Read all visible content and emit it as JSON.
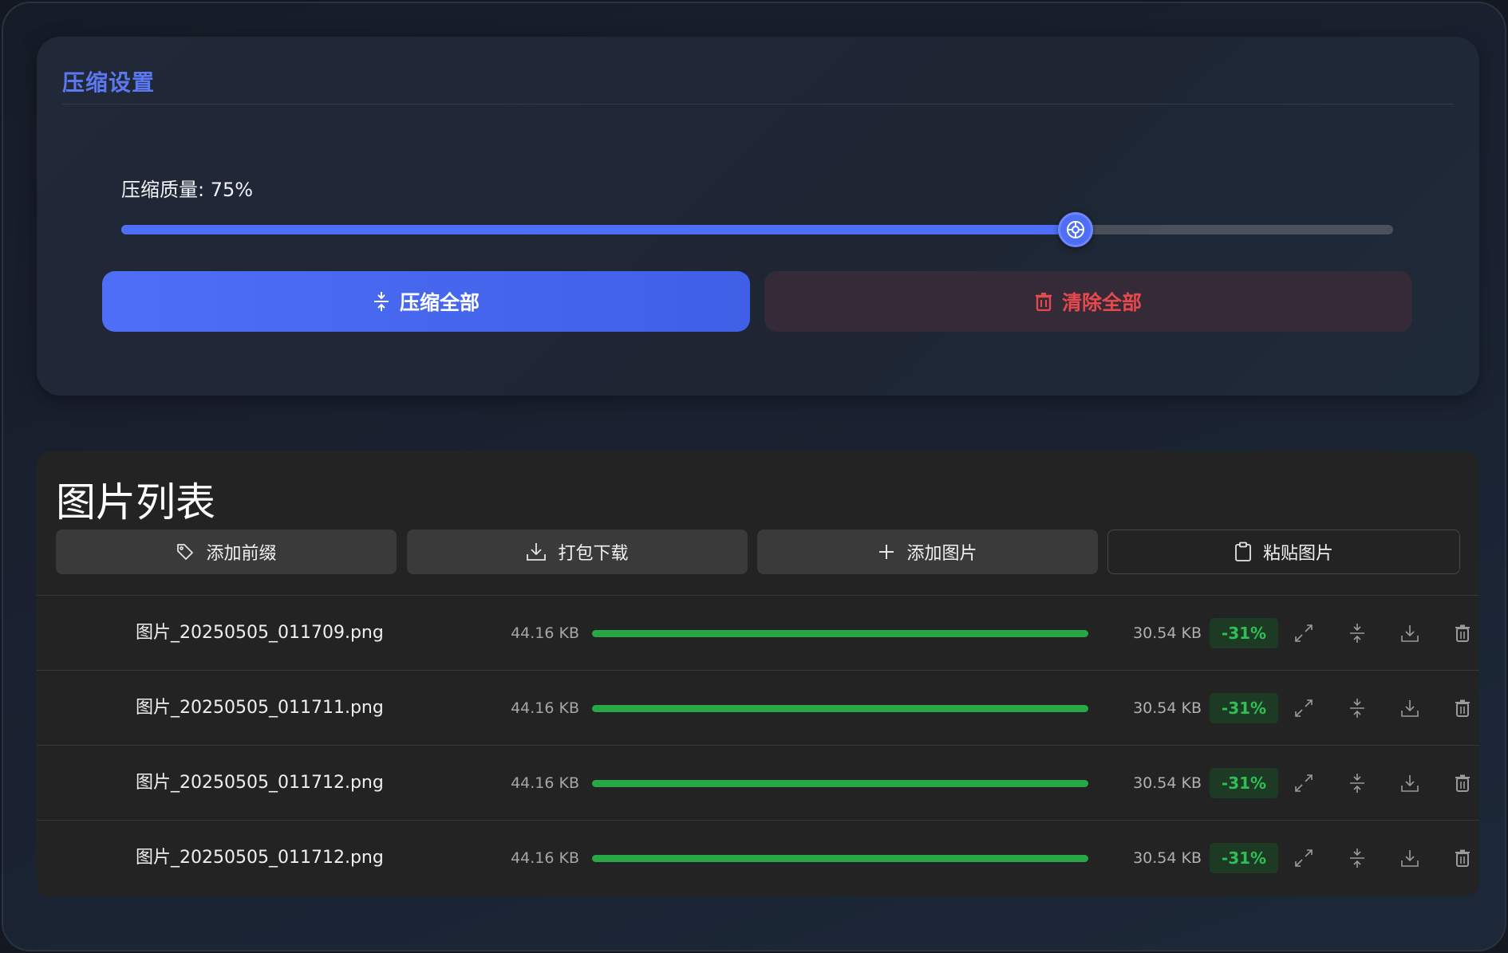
{
  "settings": {
    "title": "压缩设置",
    "quality_label": "压缩质量: 75%",
    "quality_value": 0.75,
    "compress_all_label": "压缩全部",
    "clear_all_label": "清除全部"
  },
  "image_list": {
    "title": "图片列表",
    "toolbar": {
      "add_prefix": "添加前缀",
      "pack_download": "打包下载",
      "add_image": "添加图片",
      "paste_image": "粘贴图片"
    },
    "rows": [
      {
        "filename": "图片_20250505_011709.png",
        "original_size": "44.16 KB",
        "progress": 1.0,
        "compressed_size": "30.54 KB",
        "ratio": "-31%"
      },
      {
        "filename": "图片_20250505_011711.png",
        "original_size": "44.16 KB",
        "progress": 1.0,
        "compressed_size": "30.54 KB",
        "ratio": "-31%"
      },
      {
        "filename": "图片_20250505_011712.png",
        "original_size": "44.16 KB",
        "progress": 1.0,
        "compressed_size": "30.54 KB",
        "ratio": "-31%"
      },
      {
        "filename": "图片_20250505_011712.png",
        "original_size": "44.16 KB",
        "progress": 1.0,
        "compressed_size": "30.54 KB",
        "ratio": "-31%"
      }
    ]
  },
  "icons": {
    "compress": "compress-icon",
    "trash": "trash-icon",
    "tag": "tag-icon",
    "download": "download-icon",
    "plus": "plus-icon",
    "clipboard": "clipboard-icon",
    "expand": "expand-icon"
  },
  "colors": {
    "accent": "#4f6ef7",
    "danger": "#e5484d",
    "success": "#28a745"
  }
}
